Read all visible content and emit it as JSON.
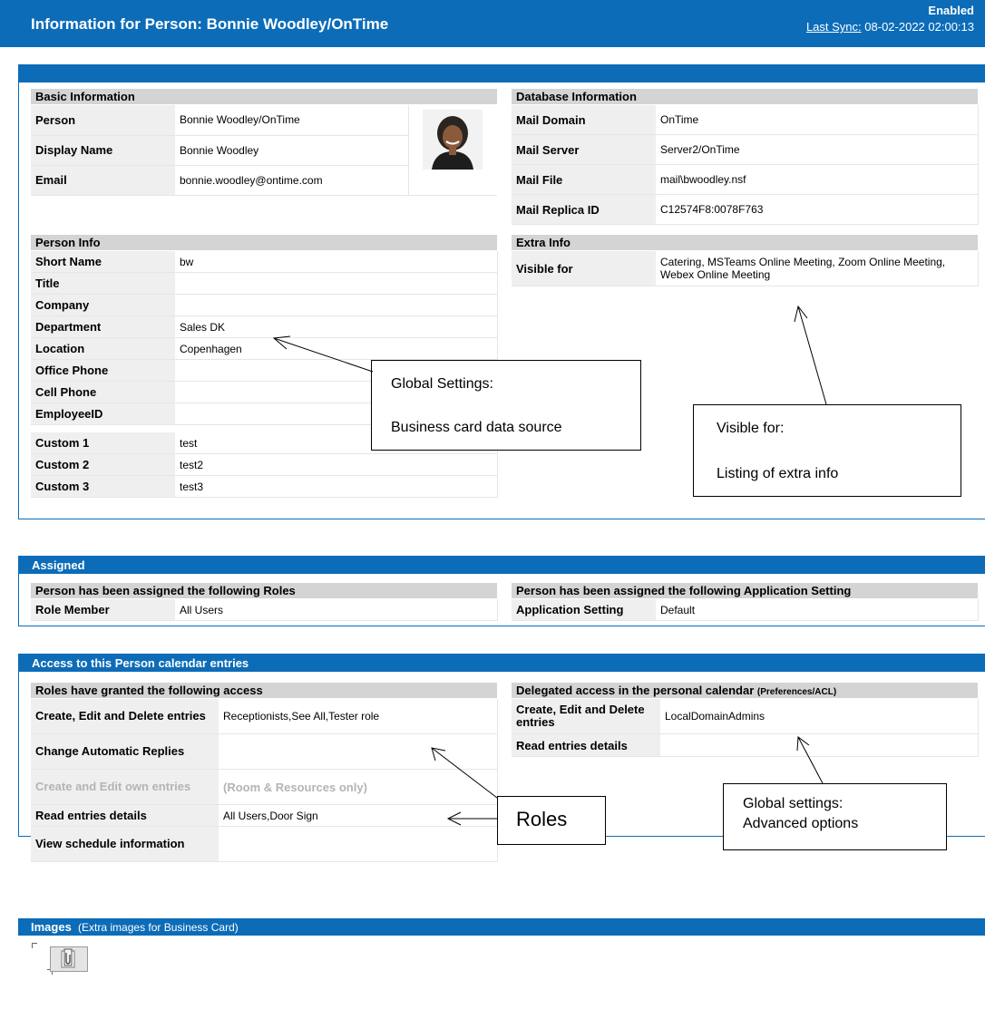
{
  "header": {
    "title": "Information for Person: Bonnie Woodley/OnTime",
    "status": "Enabled",
    "sync_label": "Last Sync:",
    "sync_value": "08-02-2022 02:00:13"
  },
  "basic": {
    "title": "Basic Information",
    "rows": [
      {
        "k": "Person",
        "v": "Bonnie Woodley/OnTime"
      },
      {
        "k": "Display Name",
        "v": "Bonnie Woodley"
      },
      {
        "k": "Email",
        "v": "bonnie.woodley@ontime.com"
      }
    ]
  },
  "database": {
    "title": "Database Information",
    "rows": [
      {
        "k": "Mail Domain",
        "v": "OnTime"
      },
      {
        "k": "Mail Server",
        "v": "Server2/OnTime"
      },
      {
        "k": "Mail File",
        "v": "mail\\bwoodley.nsf"
      },
      {
        "k": "Mail Replica ID",
        "v": "C12574F8:0078F763"
      }
    ]
  },
  "person_info": {
    "title": "Person Info",
    "rows": [
      {
        "k": "Short Name",
        "v": "bw"
      },
      {
        "k": "Title",
        "v": ""
      },
      {
        "k": "Company",
        "v": ""
      },
      {
        "k": "Department",
        "v": "Sales DK"
      },
      {
        "k": "Location",
        "v": "Copenhagen"
      },
      {
        "k": "Office Phone",
        "v": ""
      },
      {
        "k": "Cell Phone",
        "v": ""
      },
      {
        "k": "EmployeeID",
        "v": ""
      }
    ],
    "custom": [
      {
        "k": "Custom 1",
        "v": "test"
      },
      {
        "k": "Custom 2",
        "v": "test2"
      },
      {
        "k": "Custom 3",
        "v": "test3"
      }
    ]
  },
  "extra_info": {
    "title": "Extra Info",
    "rows": [
      {
        "k": "Visible for",
        "v": "Catering,  MSTeams Online Meeting,  Zoom Online Meeting,  Webex Online Meeting"
      }
    ]
  },
  "assigned": {
    "bar": "Assigned",
    "roles_title": "Person has been assigned the following Roles",
    "roles": [
      {
        "k": "Role Member",
        "v": "All Users"
      }
    ],
    "app_title": "Person has been assigned the following Application Setting",
    "app": [
      {
        "k": "Application Setting",
        "v": "Default"
      }
    ]
  },
  "access": {
    "bar": "Access to this Person calendar entries",
    "roles_title": "Roles have granted the following access",
    "roles": [
      {
        "k": "Create, Edit and Delete entries",
        "v": "Receptionists,See All,Tester role"
      },
      {
        "k": "Change Automatic Replies",
        "v": ""
      },
      {
        "k": "Create and Edit own entries",
        "v": "(Room & Resources only)"
      },
      {
        "k": "Read entries details",
        "v": "All Users,Door Sign"
      },
      {
        "k": "View schedule information",
        "v": ""
      }
    ],
    "delegated_title": "Delegated access in the personal calendar",
    "delegated_sub": "(Preferences/ACL)",
    "delegated": [
      {
        "k": "Create, Edit and Delete entries",
        "v": "LocalDomainAdmins"
      },
      {
        "k": "Read entries details",
        "v": ""
      }
    ]
  },
  "images": {
    "bar": "Images",
    "sub": "(Extra images for Business Card)"
  },
  "callouts": {
    "global_settings_line1": "Global Settings:",
    "global_settings_line2": "Business card data source",
    "visible_for_line1": "Visible for:",
    "visible_for_line2": "Listing of extra info",
    "roles": "Roles",
    "advanced_line1": "Global settings:",
    "advanced_line2": "Advanced options"
  }
}
